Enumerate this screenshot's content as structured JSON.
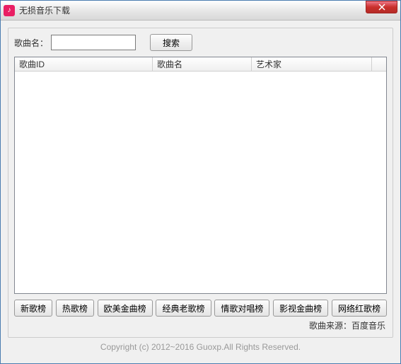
{
  "window": {
    "title": "无损音乐下载"
  },
  "search": {
    "label": "歌曲名：",
    "value": "",
    "button": "搜索"
  },
  "columns": {
    "id": "歌曲ID",
    "name": "歌曲名",
    "artist": "艺术家"
  },
  "categories": {
    "new": "新歌榜",
    "hot": "热歌榜",
    "western": "欧美金曲榜",
    "classic": "经典老歌榜",
    "love": "情歌对唱榜",
    "film": "影视金曲榜",
    "net": "网络红歌榜"
  },
  "source": "歌曲来源：百度音乐",
  "copyright": "Copyright (c)  2012~2016 Guoxp.All Rights Reserved."
}
